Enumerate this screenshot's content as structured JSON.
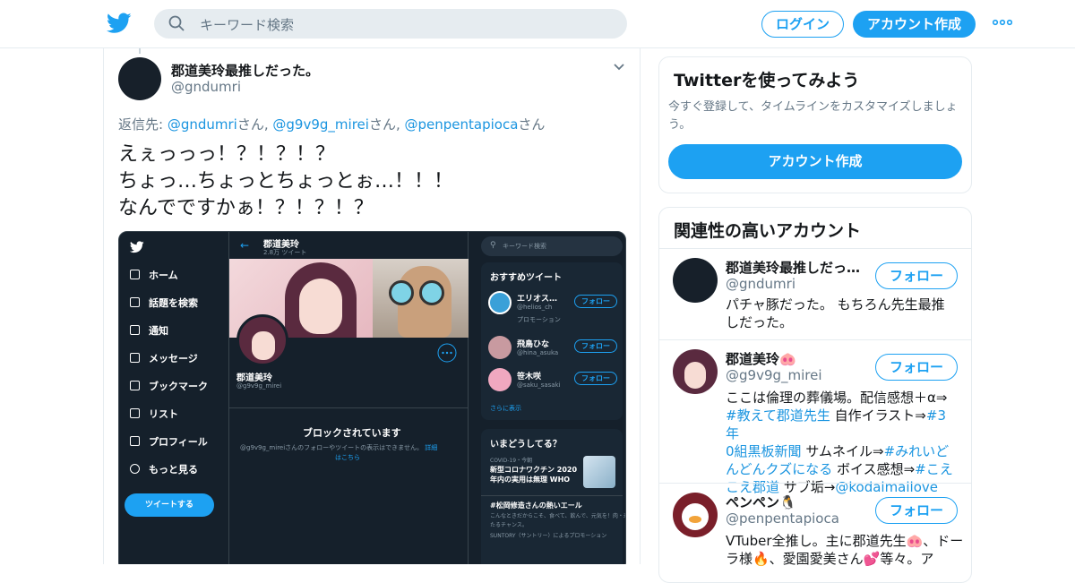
{
  "header": {
    "search_placeholder": "キーワード検索",
    "login_label": "ログイン",
    "signup_label": "アカウント作成"
  },
  "tweet": {
    "author_name": "郡道美玲最推しだった。",
    "author_handle": "@gndumri",
    "reply_prefix": "返信先: ",
    "reply_to": [
      "@gndumri",
      "@g9v9g_mirei",
      "@penpentapioca"
    ],
    "reply_suffix": "さん",
    "reply_sep": ", ",
    "lines": [
      "えぇっっっ！？！？！？",
      "ちょっ…ちょっとちょっとぉ…！！！",
      "なんでですかぁ！？！？！？"
    ],
    "media": {
      "nav_items": [
        "ホーム",
        "話題を検索",
        "通知",
        "メッセージ",
        "ブックマーク",
        "リスト",
        "プロフィール",
        "もっと見る"
      ],
      "tweet_button": "ツイートする",
      "profile_name": "郡道美玲",
      "profile_tweets": "2.8万 ツイート",
      "profile_handle": "@g9v9g_mirei",
      "blocked_title": "ブロックされています",
      "blocked_body": "@g9v9g_mireiさんのフォローやツイートの表示はできません。",
      "blocked_link_1": "詳細",
      "blocked_link_2": "はこちら",
      "search_placeholder": "キーワード検索",
      "recommend_title": "おすすめツイート",
      "recommend": [
        {
          "name": "エリオス…",
          "handle": "@helios_ch",
          "extra": "プロモーション"
        },
        {
          "name": "飛鳥ひな",
          "handle": "@hina_asuka",
          "extra": ""
        },
        {
          "name": "笹木咲",
          "handle": "@saku_sasaki",
          "extra": ""
        }
      ],
      "follow_label": "フォロー",
      "show_more": "さらに表示",
      "trends_title": "いまどうしてる？",
      "trend1_meta": "COVID-19・今朝",
      "trend1_title_1": "新型コロナワクチン 2020",
      "trend1_title_2": "年内の実用は無理 WHO",
      "trend2_title": "#松岡修造さんの熱いエール",
      "trend2_body_1": "こんなときだからこそ、食べて、飲んで、元気を！肉・米・魚、1万円分当",
      "trend2_body_2": "たるチャンス。",
      "trend2_promo": "SUNTORY（サントリー）によるプロモーション"
    }
  },
  "try_card": {
    "title": "Twitterを使ってみよう",
    "desc_1": "今すぐ登録して、タイムラインをカスタマイズしましょ",
    "desc_2": "う。",
    "button": "アカウント作成"
  },
  "related": {
    "title": "関連性の高いアカウント",
    "follow_label": "フォロー",
    "accounts": [
      {
        "name": "郡道美玲最推しだっ…",
        "handle": "@gndumri",
        "bio": [
          "パチャ豚だった。 もちろん先生最推",
          "しだった。"
        ]
      },
      {
        "name": "郡道美玲🐽",
        "handle": "@g9v9g_mirei",
        "bio_1": "ここは倫理の葬儀場。配信感想＋α⇒",
        "bio_tag1": "#教えて郡道先生",
        "bio_2": " 自作イラスト⇒",
        "bio_tag2a": "#3年",
        "bio_tag2b": "0組黒板新聞",
        "bio_3": " サムネイル⇒",
        "bio_tag3a": "#みれいど",
        "bio_tag3b": "んどんクズになる",
        "bio_4": " ボイス感想⇒",
        "bio_tag4a": "#こえ",
        "bio_tag4b": "こえ郡道",
        "bio_5": " サブ垢→",
        "bio_tag5": "@kodaimailove"
      },
      {
        "name": "ペンペン🐧",
        "handle": "@penpentapioca",
        "bio": [
          "VTuber全推し。主に郡道先生🐽、ドー",
          "ラ様🔥、愛園愛美さん💕等々。ア"
        ]
      }
    ]
  }
}
